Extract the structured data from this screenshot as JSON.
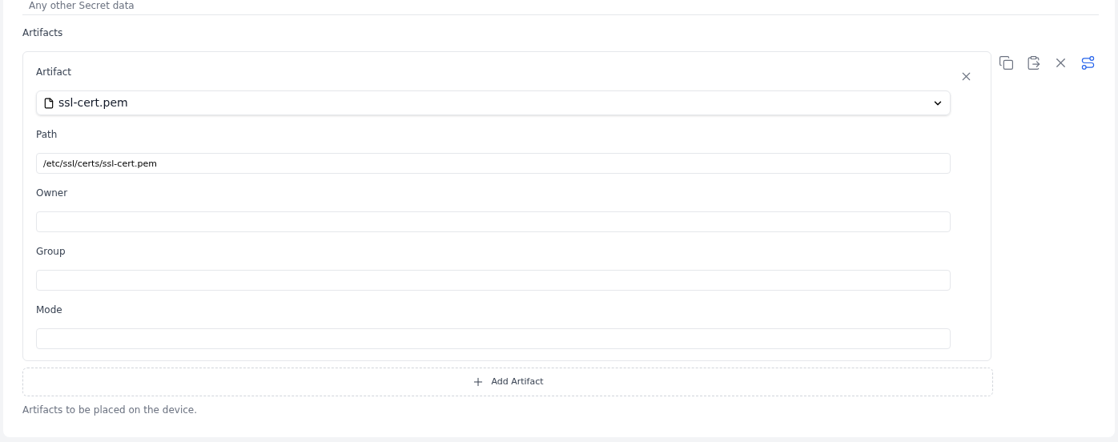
{
  "top_help": "Any other Secret data",
  "section": {
    "title": "Artifacts",
    "help": "Artifacts to be placed on the device."
  },
  "artifact": {
    "select_label": "Artifact",
    "select_value": "ssl-cert.pem",
    "fields": [
      {
        "label": "Path",
        "value": "/etc/ssl/certs/ssl-cert.pem"
      },
      {
        "label": "Owner"
      },
      {
        "label": "Group"
      },
      {
        "label": "Mode"
      }
    ]
  },
  "add_button": "Add Artifact",
  "toolbar": [
    {
      "kind": "copy",
      "active": false
    },
    {
      "kind": "paste",
      "active": false
    },
    {
      "kind": "close",
      "active": false
    },
    {
      "kind": "route",
      "active": true
    }
  ]
}
